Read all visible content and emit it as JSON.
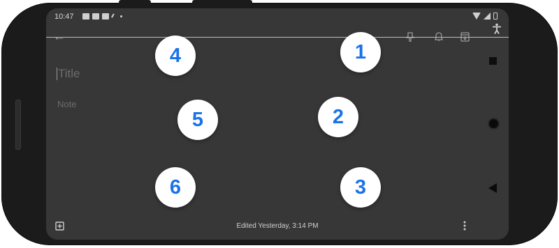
{
  "status_bar": {
    "time": "10:47",
    "icons": [
      "photo-icon",
      "news-icon",
      "youtube-icon",
      "edit-icon",
      "dot-icon"
    ],
    "right_icons": [
      "wifi-icon",
      "signal-icon",
      "battery-icon"
    ]
  },
  "toolbar": {
    "icons": [
      "back-arrow-icon",
      "pin-icon",
      "reminder-bell-icon",
      "archive-icon"
    ]
  },
  "editor": {
    "title_placeholder": "Title",
    "note_placeholder": "Note"
  },
  "bottom_bar": {
    "edited_text": "Edited Yesterday, 3:14 PM",
    "icons": [
      "add-box-icon",
      "more-vert-icon"
    ]
  },
  "nav": {
    "icons": [
      "accessibility-icon",
      "recents-square-icon",
      "home-circle-icon",
      "back-triangle-icon"
    ]
  },
  "overlay_numbers": [
    "1",
    "2",
    "3",
    "4",
    "5",
    "6"
  ],
  "colors": {
    "screen_bg": "#373737",
    "badge_text": "#1a73e8",
    "badge_bg": "#ffffff",
    "phone_body": "#1b1b1b"
  }
}
